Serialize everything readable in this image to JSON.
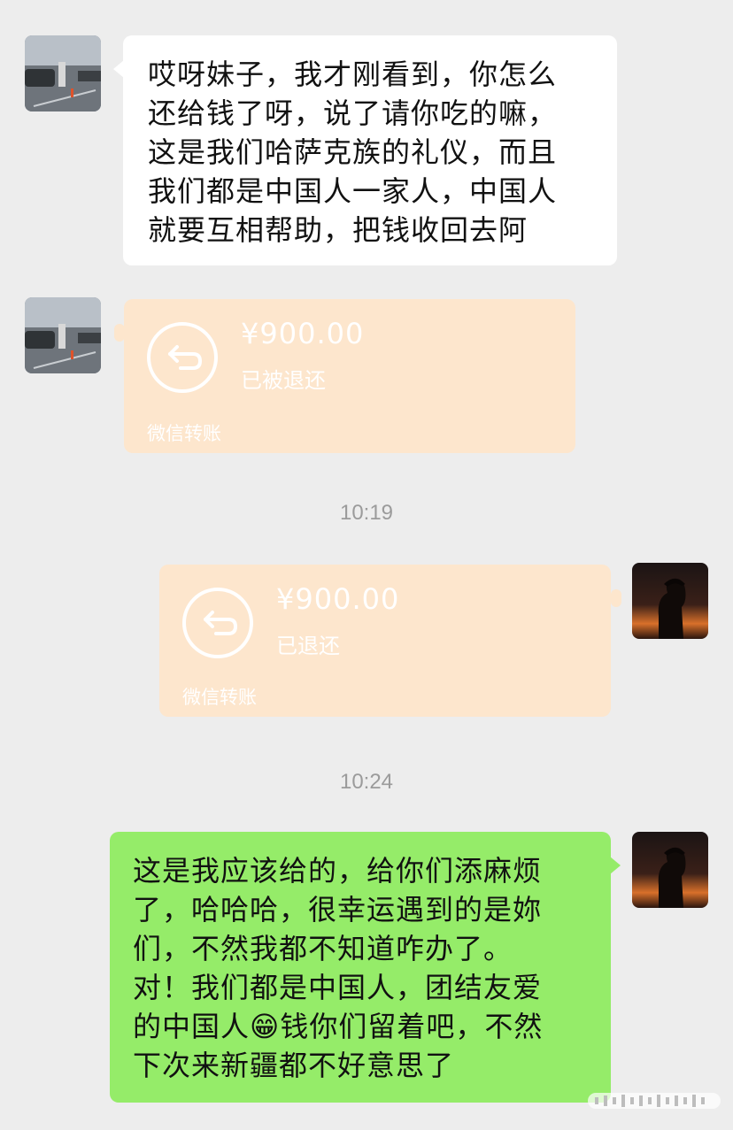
{
  "messages": {
    "m1": {
      "lines": [
        "哎呀妹子，我才刚看到，你怎么",
        "还给钱了呀，说了请你吃的嘛，",
        "这是我们哈萨克族的礼仪，而且",
        "我们都是中国人一家人，中国人",
        "就要互相帮助，把钱收回去阿"
      ]
    },
    "t1": {
      "amount": "¥900.00",
      "status": "已被退还",
      "footer": "微信转账"
    },
    "time1": "10:19",
    "t2": {
      "amount": "¥900.00",
      "status": "已退还",
      "footer": "微信转账"
    },
    "time2": "10:24",
    "m2": {
      "line1": "这是我应该给的，给你们添麻烦",
      "line2": "了，哈哈哈，很幸运遇到的是妳",
      "line3": "们，不然我都不知道咋办了。",
      "line4": "对！我们都是中国人，团结友爱",
      "line5_before": "的中国人",
      "line5_emoji": "😁",
      "line5_after": "钱你们留着吧，不然",
      "line6": "下次来新疆都不好意思了"
    }
  },
  "colors": {
    "background": "#ededed",
    "incoming_bubble": "#ffffff",
    "outgoing_bubble": "#95ec69",
    "transfer_card": "#fde6cd",
    "timestamp_text": "#9b9b9b"
  }
}
